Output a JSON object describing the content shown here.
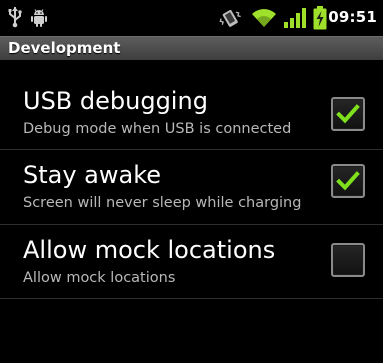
{
  "status_bar": {
    "time": "09:51",
    "icons": [
      "usb-icon",
      "android-debug-icon",
      "vibrate-icon",
      "wifi-icon",
      "signal-icon",
      "battery-charging-icon"
    ]
  },
  "title_bar": {
    "title": "Development"
  },
  "preferences": [
    {
      "title": "USB debugging",
      "summary": "Debug mode when USB is connected",
      "checked": true
    },
    {
      "title": "Stay awake",
      "summary": "Screen will never sleep while charging",
      "checked": true
    },
    {
      "title": "Allow mock locations",
      "summary": "Allow mock locations",
      "checked": false
    }
  ],
  "colors": {
    "check_green": "#7ee11c",
    "background": "#000000",
    "title_bar": "#4a4a4a",
    "status_icon_green": "#9ee02a"
  }
}
